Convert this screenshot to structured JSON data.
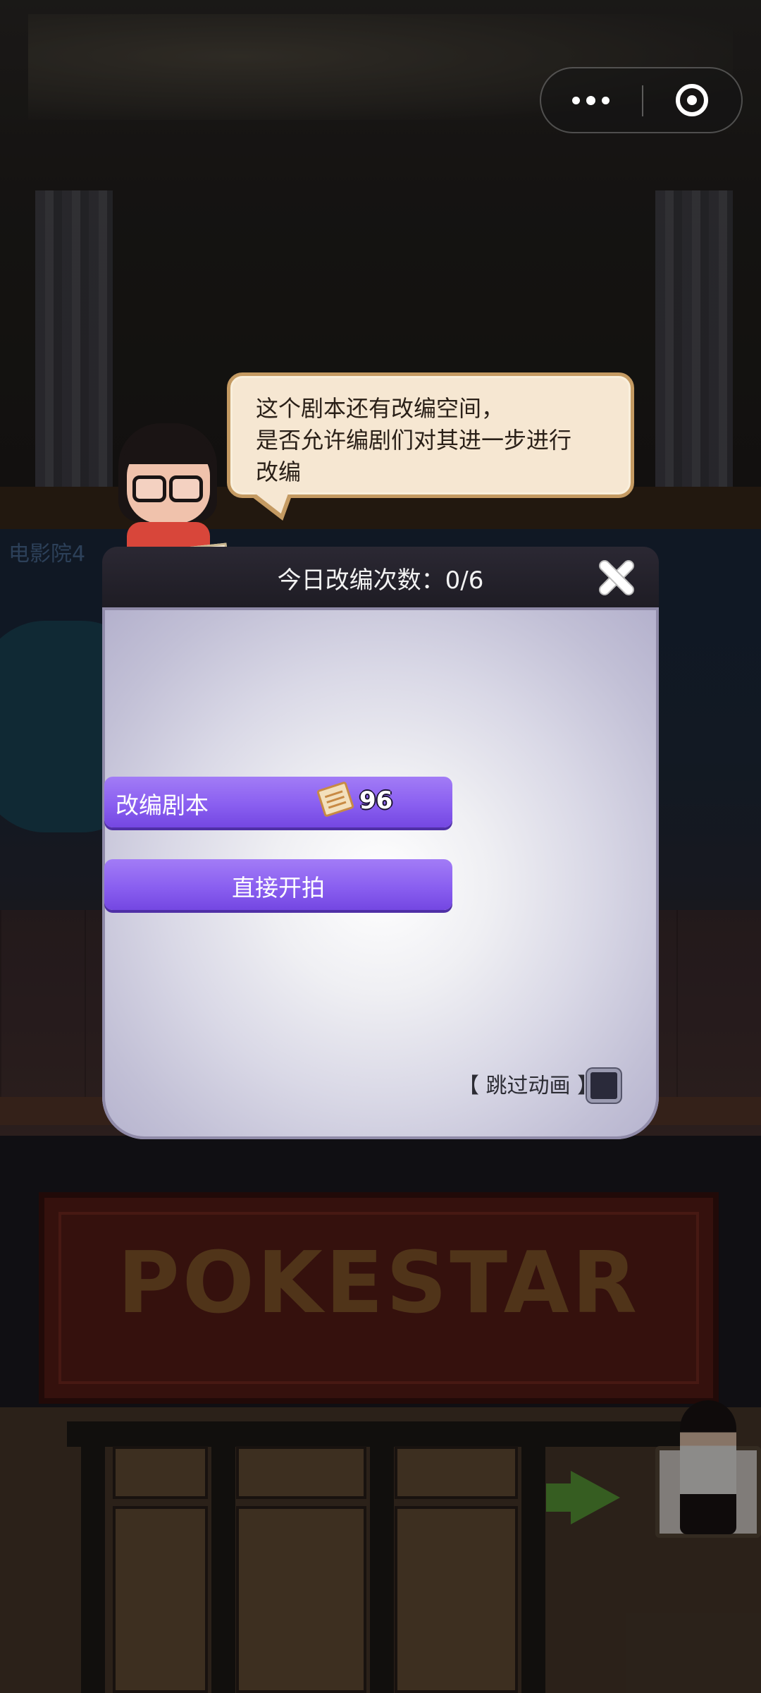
{
  "colors": {
    "button_purple": "#8a5ff0",
    "bubble_fill": "#f6e7d2",
    "bubble_border": "#c49a62",
    "dialog_header": "#24222b"
  },
  "capsule": {
    "more_icon": "more-dots-icon",
    "close_icon": "target-circle-icon"
  },
  "scene": {
    "label": "电影院4",
    "sign": "POKESTAR"
  },
  "speech_bubble": {
    "line1": "这个剧本还有改编空间，",
    "line2": "是否允许编剧们对其进一步进行",
    "line3": "改编"
  },
  "dialog": {
    "title": "今日改编次数：0/6",
    "adapt_button_label": "改编剧本",
    "adapt_cost": "96",
    "adapt_cost_icon": "script-paper-icon",
    "shoot_button_label": "直接开拍",
    "skip_label": "【 跳过动画 】",
    "skip_checked": false
  }
}
